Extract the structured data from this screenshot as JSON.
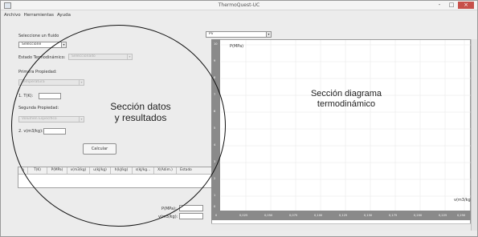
{
  "window": {
    "title": "ThermoQuest-UC",
    "minimize": "-",
    "maximize": "□",
    "close": "×"
  },
  "menu": [
    "Archivo",
    "Herramientas",
    "Ayuda"
  ],
  "left_panel": {
    "fluid_label": "Seleccione un fluido",
    "fluid_value": "Seleccione",
    "state_label": "Estado Termodinámico:",
    "state_value": "Seleccionado",
    "prop1_label": "Primera Propiedad:",
    "prop1_value": "Temperatura",
    "prop1_input_label": "1. T(K):",
    "prop2_label": "Segunda Propiedad:",
    "prop2_value": "Volumen Específico",
    "prop2_input_label": "2. v(m3/kg):",
    "calc_button": "Calcular",
    "results_columns": [
      "n",
      "T(K)",
      "P(MPa)",
      "v(m3/kg)",
      "u(kJ/kg)",
      "h(kJ/kg)",
      "s(kJ/kg...",
      "X(Adim.)",
      "Estado"
    ]
  },
  "right_panel": {
    "selector_value": "Pv",
    "y_axis_label": "P(MPa)",
    "x_axis_label": "v(m3/kg)",
    "y_ticks": [
      "10",
      "9",
      "8",
      "7",
      "6",
      "5",
      "4",
      "3",
      "2",
      "1",
      "0"
    ],
    "x_ticks": [
      "0,025",
      "0,050",
      "0,075",
      "0,100",
      "0,125",
      "0,150",
      "0,175",
      "0,200",
      "0,225",
      "0,250"
    ],
    "x_origin": "0"
  },
  "cursor_readout": {
    "p_label": "P(MPa):",
    "v_label": "v(m3/kg):"
  },
  "annotations": {
    "left_line1": "Sección datos",
    "left_line2": "y resultados",
    "right_line1": "Sección diagrama",
    "right_line2": "termodinámico"
  }
}
